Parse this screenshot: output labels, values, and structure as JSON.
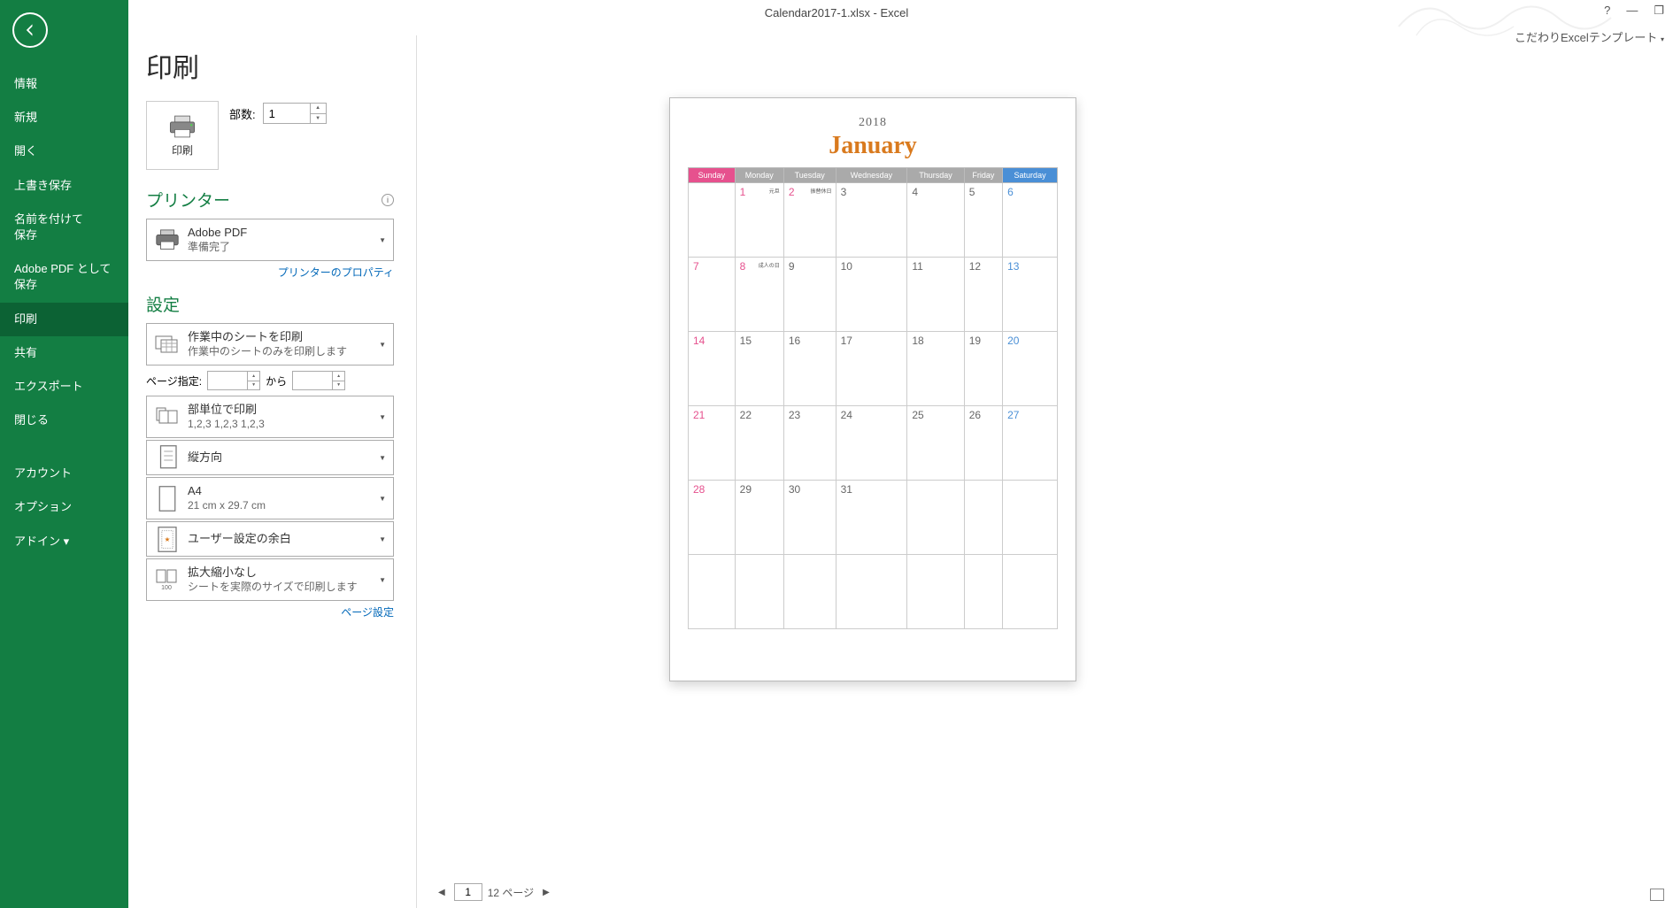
{
  "window": {
    "title": "Calendar2017-1.xlsx - Excel",
    "template_label": "こだわりExcelテンプレート"
  },
  "sidebar": {
    "items": [
      "情報",
      "新規",
      "開く",
      "上書き保存",
      "名前を付けて\n保存",
      "Adobe PDF として\n保存",
      "印刷",
      "共有",
      "エクスポート",
      "閉じる",
      "アカウント",
      "オプション",
      "アドイン"
    ],
    "selected": "印刷"
  },
  "print": {
    "heading": "印刷",
    "button_label": "印刷",
    "copies_label": "部数:",
    "copies_value": "1"
  },
  "printer": {
    "section": "プリンター",
    "name": "Adobe PDF",
    "status": "準備完了",
    "properties_link": "プリンターのプロパティ"
  },
  "settings": {
    "section": "設定",
    "scope": {
      "title": "作業中のシートを印刷",
      "sub": "作業中のシートのみを印刷します"
    },
    "pages": {
      "label": "ページ指定:",
      "to": "から"
    },
    "collate": {
      "title": "部単位で印刷",
      "sub": "1,2,3   1,2,3   1,2,3"
    },
    "orientation": {
      "title": "縦方向"
    },
    "paper": {
      "title": "A4",
      "sub": "21 cm x 29.7 cm"
    },
    "margins": {
      "title": "ユーザー設定の余白"
    },
    "scaling": {
      "title": "拡大縮小なし",
      "sub": "シートを実際のサイズで印刷します"
    },
    "page_setup_link": "ページ設定"
  },
  "preview": {
    "year": "2018",
    "month": "January",
    "days": [
      "Sunday",
      "Monday",
      "Tuesday",
      "Wednesday",
      "Thursday",
      "Friday",
      "Saturday"
    ],
    "notes": {
      "1": "元旦",
      "2": "振替休日",
      "8": "成人の日"
    },
    "weeks": [
      [
        "",
        "1",
        "2",
        "3",
        "4",
        "5",
        "6"
      ],
      [
        "7",
        "8",
        "9",
        "10",
        "11",
        "12",
        "13"
      ],
      [
        "14",
        "15",
        "16",
        "17",
        "18",
        "19",
        "20"
      ],
      [
        "21",
        "22",
        "23",
        "24",
        "25",
        "26",
        "27"
      ],
      [
        "28",
        "29",
        "30",
        "31",
        "",
        "",
        ""
      ],
      [
        "",
        "",
        "",
        "",
        "",
        "",
        ""
      ]
    ],
    "holidays": [
      "1",
      "2",
      "8"
    ],
    "pager": {
      "current": "1",
      "total": "12 ページ"
    }
  }
}
